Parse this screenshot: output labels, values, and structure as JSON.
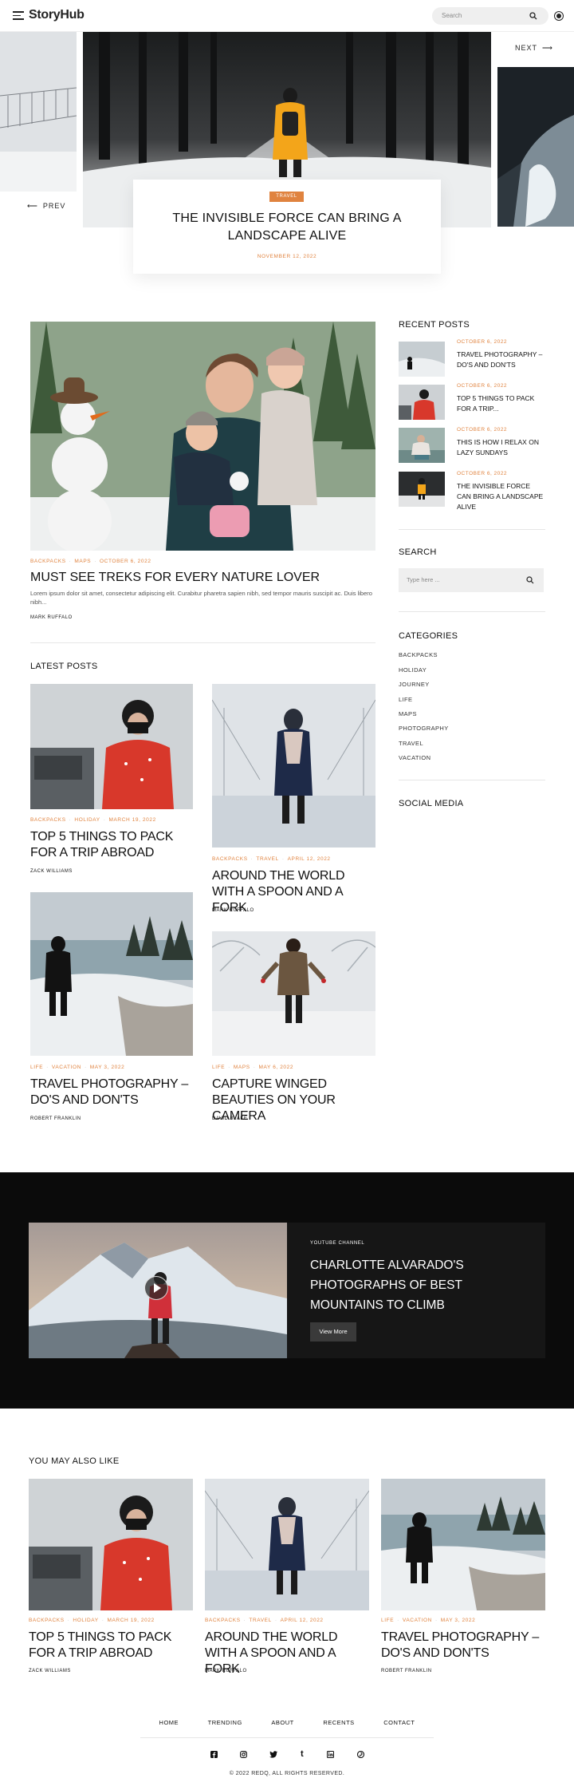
{
  "header": {
    "logo": "StoryHub",
    "search_placeholder": "Search"
  },
  "hero": {
    "prev_label": "PREV",
    "next_label": "NEXT",
    "badge": "TRAVEL",
    "title": "THE INVISIBLE FORCE CAN BRING A LANDSCAPE ALIVE",
    "date": "NOVEMBER 12, 2022"
  },
  "featured": {
    "meta": [
      "BACKPACKS",
      "MAPS",
      "OCTOBER 6, 2022"
    ],
    "title": "MUST SEE TREKS FOR EVERY NATURE LOVER",
    "excerpt": "Lorem ipsum dolor sit amet, consectetur adipiscing elit. Curabitur pharetra sapien nibh, sed tempor mauris suscipit ac. Duis libero nibh...",
    "author": "MARK RUFFALO"
  },
  "latest": {
    "heading": "LATEST POSTS",
    "posts": [
      {
        "meta": [
          "BACKPACKS",
          "HOLIDAY",
          "MARCH 19, 2022"
        ],
        "title": "TOP 5 THINGS TO PACK FOR A TRIP ABROAD",
        "author": "ZACK WILLIAMS"
      },
      {
        "meta": [
          "BACKPACKS",
          "TRAVEL",
          "APRIL 12, 2022"
        ],
        "title": "AROUND THE WORLD WITH A SPOON AND A FORK",
        "author": "MARK RUFFALO"
      },
      {
        "meta": [
          "LIFE",
          "VACATION",
          "MAY 3, 2022"
        ],
        "title": "TRAVEL PHOTOGRAPHY – DO'S AND DON'TS",
        "author": "ROBERT FRANKLIN"
      },
      {
        "meta": [
          "LIFE",
          "MAPS",
          "MAY 6, 2022"
        ],
        "title": "CAPTURE WINGED BEAUTIES ON YOUR CAMERA",
        "author": "DAVID BLAKE"
      }
    ]
  },
  "sidebar": {
    "recent_heading": "RECENT POSTS",
    "recent": [
      {
        "date": "OCTOBER 6, 2022",
        "title": "TRAVEL PHOTOGRAPHY – DO'S AND DON'TS"
      },
      {
        "date": "OCTOBER 6, 2022",
        "title": "TOP 5 THINGS TO PACK FOR A TRIP..."
      },
      {
        "date": "OCTOBER 6, 2022",
        "title": "THIS IS HOW I RELAX ON LAZY SUNDAYS"
      },
      {
        "date": "OCTOBER 6, 2022",
        "title": "THE INVISIBLE FORCE CAN BRING A LANDSCAPE ALIVE"
      }
    ],
    "search_heading": "SEARCH",
    "search_placeholder": "Type here ...",
    "categories_heading": "CATEGORIES",
    "categories": [
      "BACKPACKS",
      "HOLIDAY",
      "JOURNEY",
      "LIFE",
      "MAPS",
      "PHOTOGRAPHY",
      "TRAVEL",
      "VACATION"
    ],
    "social_heading": "SOCIAL MEDIA"
  },
  "video": {
    "label": "YOUTUBE CHANNEL",
    "title": "CHARLOTTE ALVARADO'S PHOTOGRAPHS OF BEST MOUNTAINS TO CLIMB",
    "button": "View More"
  },
  "also": {
    "heading": "YOU MAY ALSO LIKE",
    "posts": [
      {
        "meta": [
          "BACKPACKS",
          "HOLIDAY",
          "MARCH 19, 2022"
        ],
        "title": "TOP 5 THINGS TO PACK FOR A TRIP ABROAD",
        "author": "ZACK WILLIAMS"
      },
      {
        "meta": [
          "BACKPACKS",
          "TRAVEL",
          "APRIL 12, 2022"
        ],
        "title": "AROUND THE WORLD WITH A SPOON AND A FORK",
        "author": "MARK RUFFALO"
      },
      {
        "meta": [
          "LIFE",
          "VACATION",
          "MAY 3, 2022"
        ],
        "title": "TRAVEL PHOTOGRAPHY – DO'S AND DON'TS",
        "author": "ROBERT FRANKLIN"
      }
    ]
  },
  "footer": {
    "nav": [
      "HOME",
      "TRENDING",
      "ABOUT",
      "RECENTS",
      "CONTACT"
    ],
    "social_icons": [
      "facebook-icon",
      "instagram-icon",
      "twitter-icon",
      "tumblr-icon",
      "linkedin-icon",
      "pinterest-icon"
    ],
    "copyright": "© 2022 REDQ, ALL RIGHTS RESERVED."
  },
  "colors": {
    "accent": "#e0833f",
    "dark": "#0b0b0b",
    "card_dark": "#161616"
  }
}
